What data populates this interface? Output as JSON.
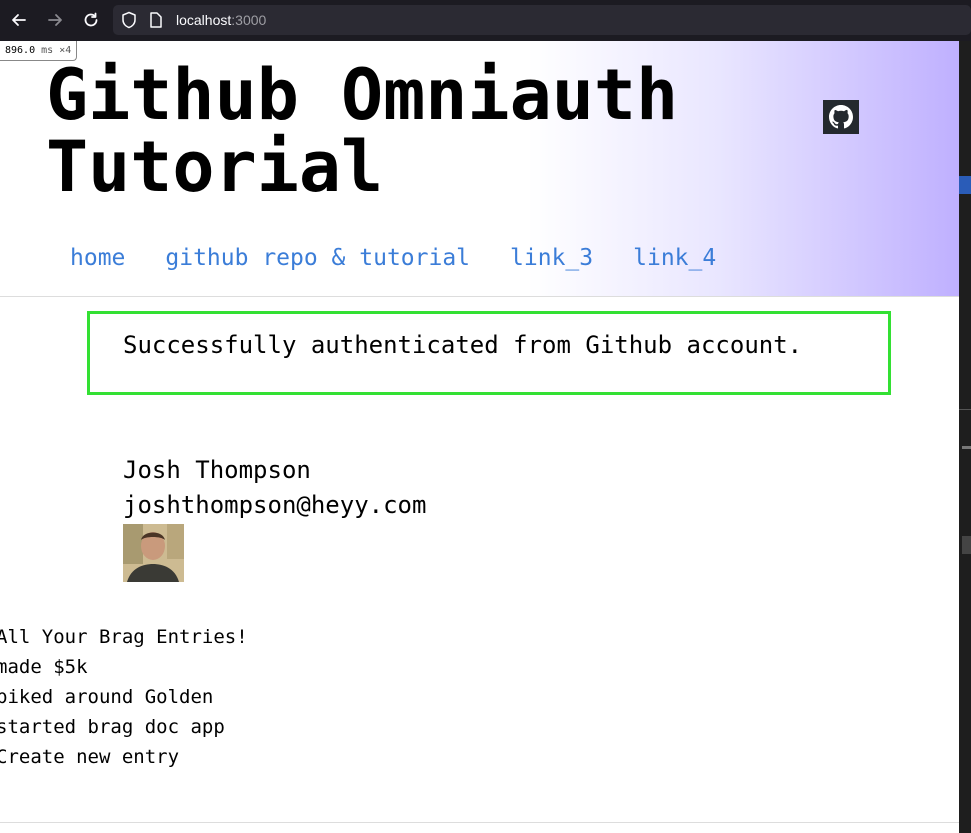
{
  "browser": {
    "url_host": "localhost",
    "url_port": ":3000",
    "icons": [
      "back-arrow-icon",
      "forward-arrow-icon",
      "reload-icon",
      "shield-icon",
      "page-icon"
    ]
  },
  "timing": {
    "value": "896.0",
    "unit": "ms",
    "multiplier": "×4"
  },
  "header": {
    "title_line1": "Github Omniauth",
    "title_line2": "Tutorial",
    "github_icon": "github-icon",
    "nav": [
      {
        "label": "home"
      },
      {
        "label": "github repo & tutorial"
      },
      {
        "label": "link_3"
      },
      {
        "label": "link_4"
      }
    ],
    "gradient_end_color": "#bfb0ff",
    "link_color": "#3b7dd8"
  },
  "flash": {
    "message": "Successfully authenticated from Github account.",
    "border_color": "#33e033"
  },
  "user": {
    "name": "Josh Thompson",
    "email": "joshthompson@heyy.com"
  },
  "brag": {
    "heading": "All Your Brag Entries!",
    "entries": [
      "made $5k",
      "biked around Golden",
      "started brag doc app"
    ],
    "create_link": "Create new entry"
  }
}
